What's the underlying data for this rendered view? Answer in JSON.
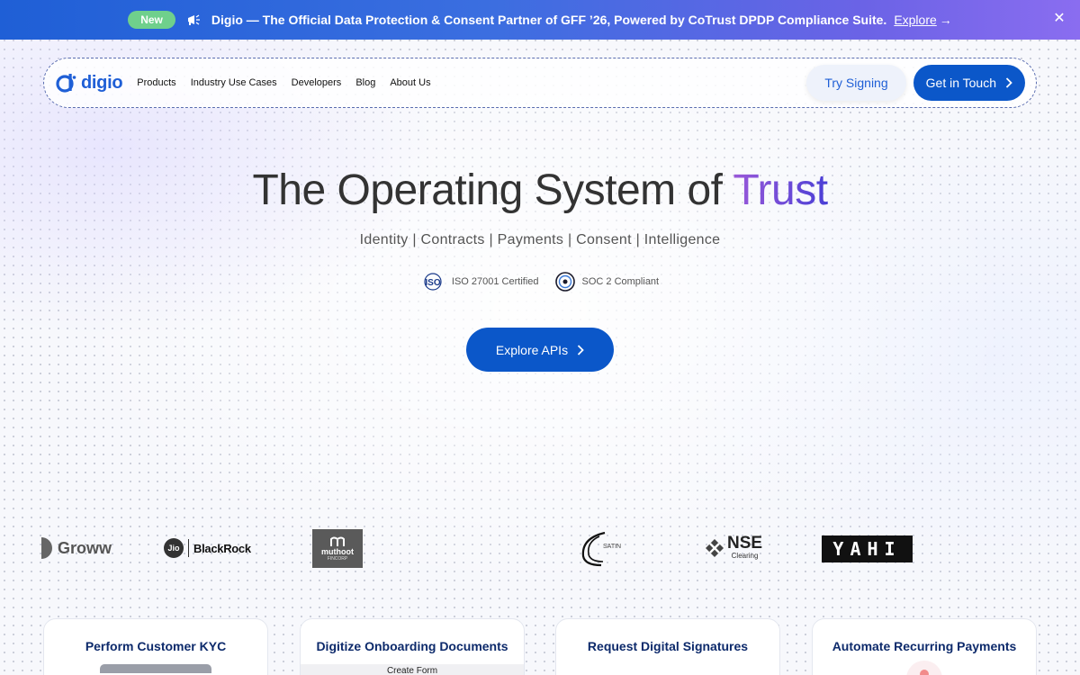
{
  "banner": {
    "badge": "New",
    "message": "Digio — The Official Data Protection & Consent Partner of GFF ’26, Powered by CoTrust DPDP Compliance Suite.",
    "link": "Explore",
    "link_arrow": "→",
    "close": "✕"
  },
  "nav": {
    "logo_text": "digio",
    "menu": [
      "Products",
      "Industry Use Cases",
      "Developers",
      "Blog",
      "About Us"
    ],
    "try_signing": "Try Signing",
    "get_in_touch": "Get in Touch"
  },
  "hero": {
    "title_main": "The Operating System of ",
    "title_accent": "Trust",
    "subtitle": "Identity | Contracts | Payments | Consent | Intelligence",
    "cert_iso": "ISO 27001 Certified",
    "cert_soc": "SOC 2 Compliant",
    "iso_logo": "ISO",
    "cta": "Explore APIs"
  },
  "clients": {
    "groww": "Groww",
    "jio": "Jio",
    "blackrock": "BlackRock",
    "muthoot": "muthoot",
    "muthoot_sub": "FINCORP",
    "satin": "SATIN",
    "nse": "NSE",
    "nse_sub": "Clearing",
    "yahi": "YAHI"
  },
  "cards": [
    {
      "title": "Perform Customer KYC"
    },
    {
      "title": "Digitize Onboarding Documents",
      "extra": "Create Form"
    },
    {
      "title": "Request Digital Signatures"
    },
    {
      "title": "Automate Recurring Payments"
    }
  ],
  "colors": {
    "primary": "#0b57c9",
    "accent_start": "#9b59d8",
    "accent_end": "#4a3fd6",
    "badge": "#6fd08c"
  }
}
